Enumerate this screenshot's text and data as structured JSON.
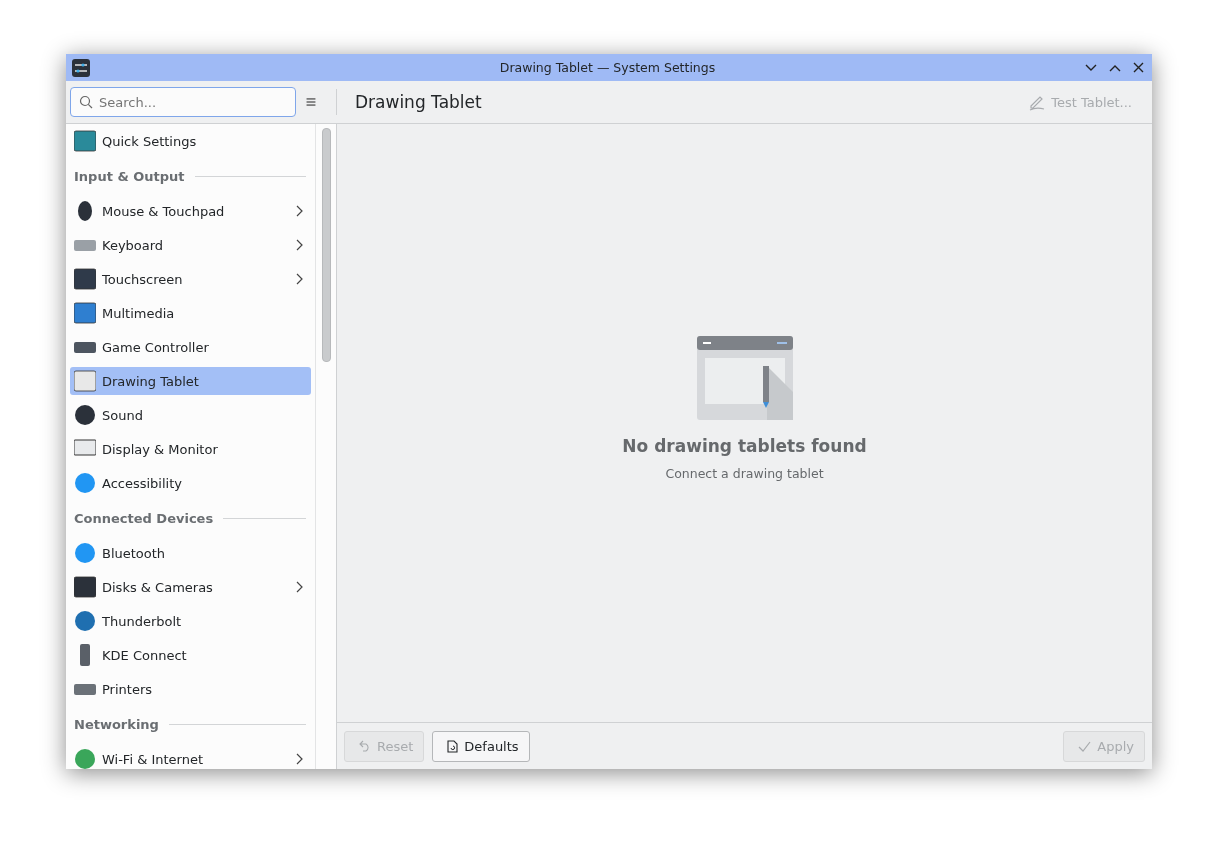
{
  "window": {
    "title": "Drawing Tablet — System Settings"
  },
  "search": {
    "placeholder": "Search..."
  },
  "page_title": "Drawing Tablet",
  "test_button": {
    "label": "Test Tablet...",
    "disabled": true
  },
  "sidebar": {
    "items": [
      {
        "kind": "item",
        "label": "Quick Settings",
        "selected": false,
        "has_children": false
      },
      {
        "kind": "section",
        "label": "Input & Output"
      },
      {
        "kind": "item",
        "label": "Mouse & Touchpad",
        "selected": false,
        "has_children": true
      },
      {
        "kind": "item",
        "label": "Keyboard",
        "selected": false,
        "has_children": true
      },
      {
        "kind": "item",
        "label": "Touchscreen",
        "selected": false,
        "has_children": true
      },
      {
        "kind": "item",
        "label": "Multimedia",
        "selected": false,
        "has_children": false
      },
      {
        "kind": "item",
        "label": "Game Controller",
        "selected": false,
        "has_children": false
      },
      {
        "kind": "item",
        "label": "Drawing Tablet",
        "selected": true,
        "has_children": false
      },
      {
        "kind": "item",
        "label": "Sound",
        "selected": false,
        "has_children": false
      },
      {
        "kind": "item",
        "label": "Display & Monitor",
        "selected": false,
        "has_children": false
      },
      {
        "kind": "item",
        "label": "Accessibility",
        "selected": false,
        "has_children": false
      },
      {
        "kind": "section",
        "label": "Connected Devices"
      },
      {
        "kind": "item",
        "label": "Bluetooth",
        "selected": false,
        "has_children": false
      },
      {
        "kind": "item",
        "label": "Disks & Cameras",
        "selected": false,
        "has_children": true
      },
      {
        "kind": "item",
        "label": "Thunderbolt",
        "selected": false,
        "has_children": false
      },
      {
        "kind": "item",
        "label": "KDE Connect",
        "selected": false,
        "has_children": false
      },
      {
        "kind": "item",
        "label": "Printers",
        "selected": false,
        "has_children": false
      },
      {
        "kind": "section",
        "label": "Networking"
      },
      {
        "kind": "item",
        "label": "Wi-Fi & Internet",
        "selected": false,
        "has_children": true
      }
    ]
  },
  "empty_state": {
    "title": "No drawing tablets found",
    "subtitle": "Connect a drawing tablet"
  },
  "footer": {
    "buttons": [
      {
        "kind": "reset",
        "label": "Reset",
        "disabled": true
      },
      {
        "kind": "defaults",
        "label": "Defaults",
        "disabled": false
      },
      {
        "kind": "apply",
        "label": "Apply",
        "disabled": true
      }
    ]
  }
}
